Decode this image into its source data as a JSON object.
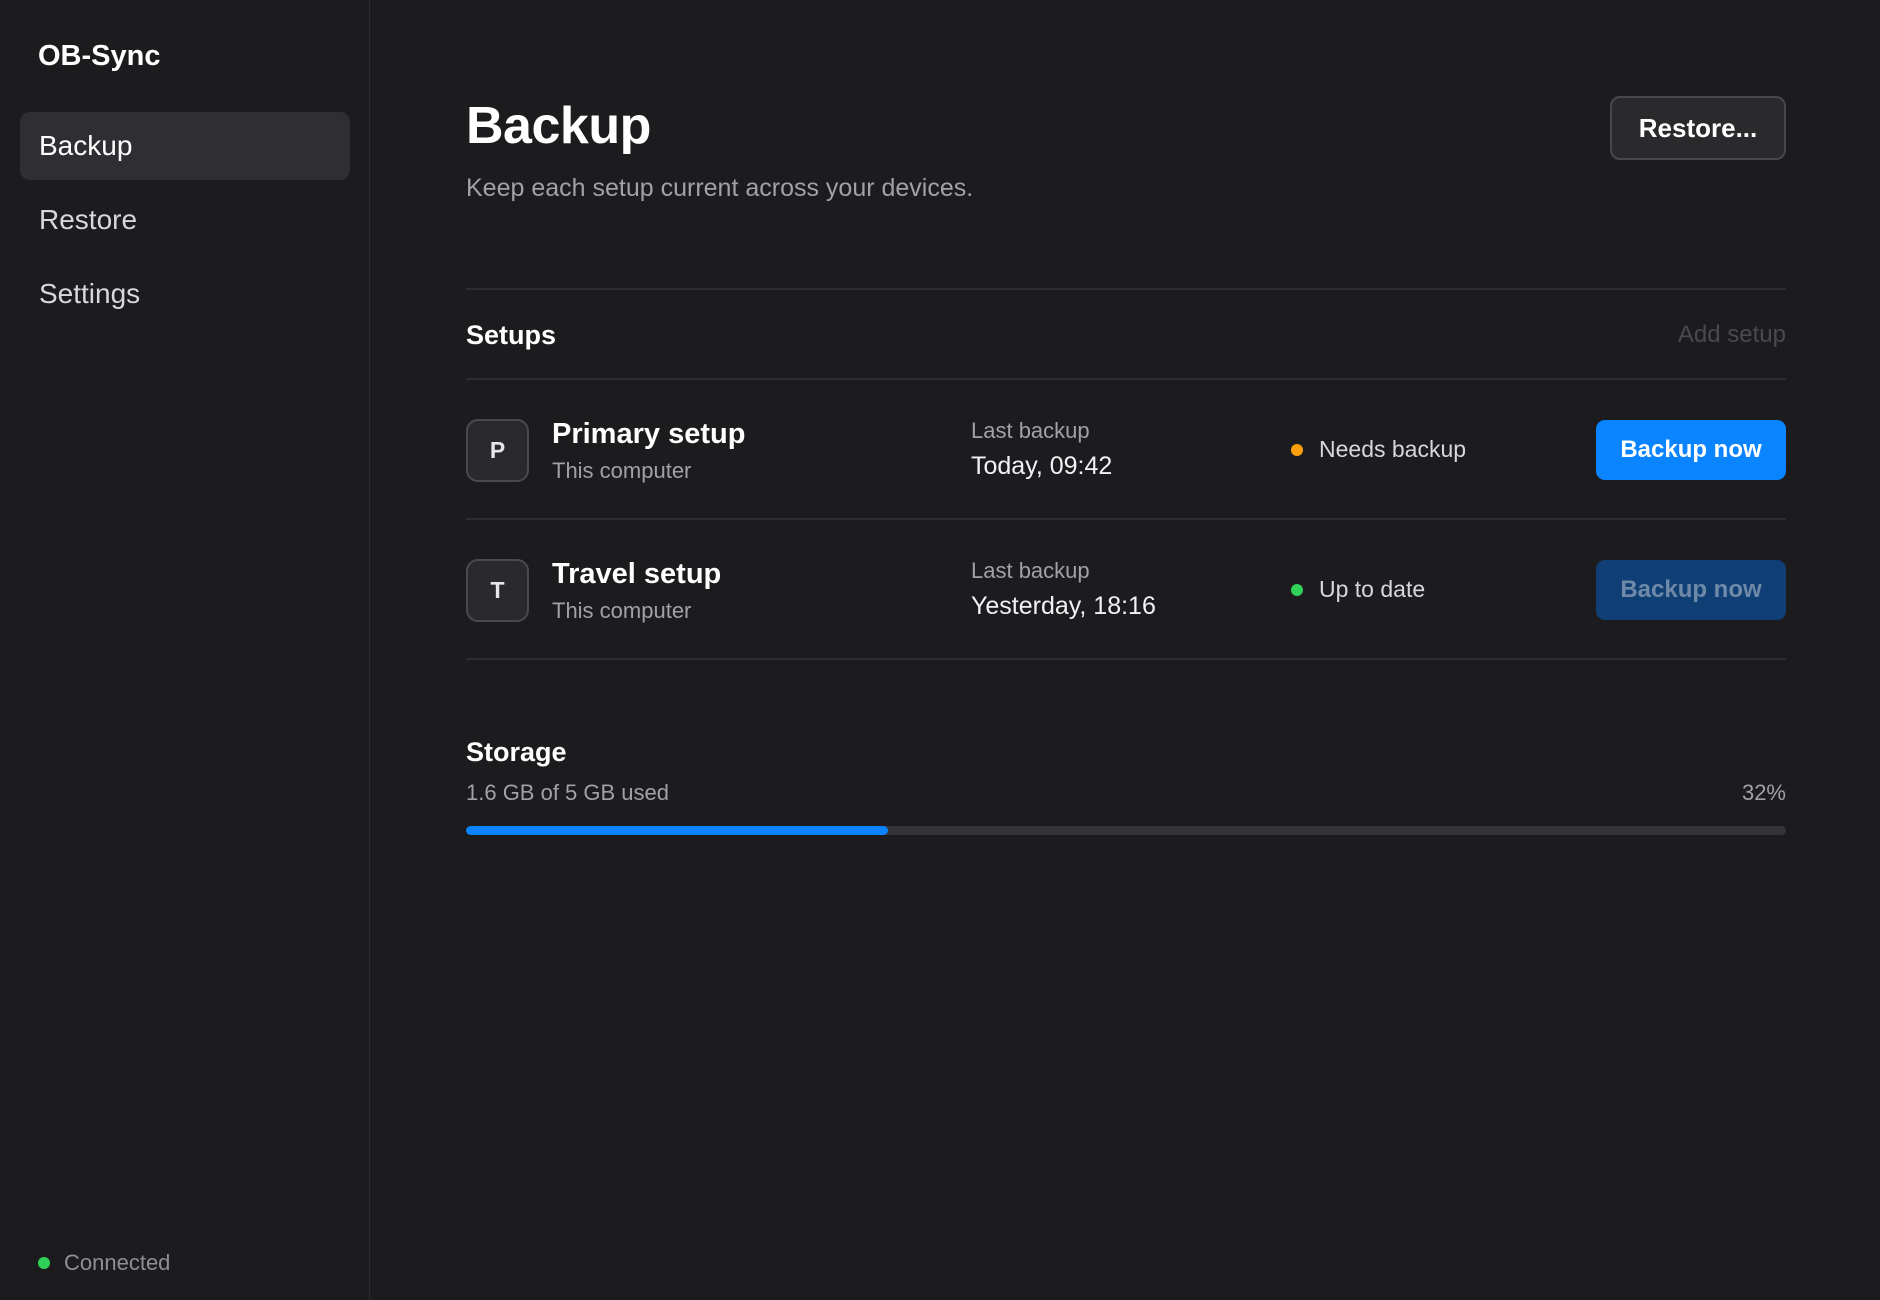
{
  "sidebar": {
    "app_title": "OB-Sync",
    "items": [
      {
        "label": "Backup",
        "active": true
      },
      {
        "label": "Restore",
        "active": false
      },
      {
        "label": "Settings",
        "active": false
      }
    ],
    "status": {
      "label": "Connected",
      "color": "#30d158"
    }
  },
  "header": {
    "title": "Backup",
    "subtitle": "Keep each setup current across your devices.",
    "restore_button": "Restore..."
  },
  "setups": {
    "section_title": "Setups",
    "add_label": "Add setup",
    "rows": [
      {
        "initial": "P",
        "name": "Primary setup",
        "sub": "This computer",
        "last_backup_label": "Last backup",
        "last_backup": "Today, 09:42",
        "status": "Needs backup",
        "status_color": "#ff9f0a",
        "button": "Backup now",
        "button_style": "primary"
      },
      {
        "initial": "T",
        "name": "Travel setup",
        "sub": "This computer",
        "last_backup_label": "Last backup",
        "last_backup": "Yesterday, 18:16",
        "status": "Up to date",
        "status_color": "#30d158",
        "button": "Backup now",
        "button_style": "muted"
      }
    ]
  },
  "storage": {
    "title": "Storage",
    "used_text": "1.6 GB of 5 GB used",
    "percent_text": "32%",
    "fraction": 0.32
  },
  "colors": {
    "accent": "#0a84ff",
    "background": "#1c1c1e"
  }
}
